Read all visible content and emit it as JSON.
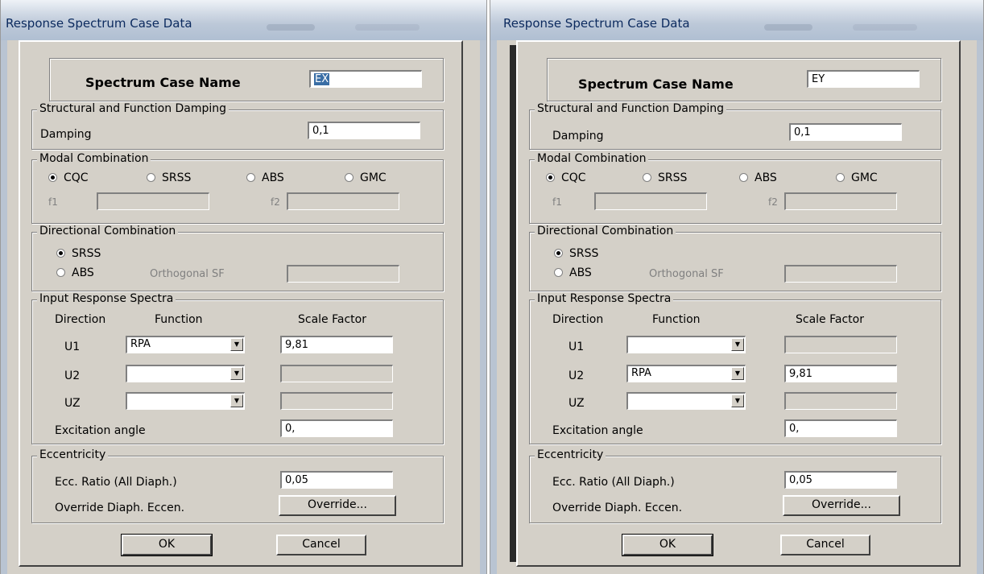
{
  "left": {
    "title": "Response Spectrum Case Data",
    "case_name_label": "Spectrum Case Name",
    "case_name": "EX",
    "damping_group": "Structural and Function Damping",
    "damping_label": "Damping",
    "damping": "0,1",
    "modal_group": "Modal Combination",
    "modal_options": [
      "CQC",
      "SRSS",
      "ABS",
      "GMC"
    ],
    "modal_selected": "CQC",
    "f1_label": "f1",
    "f2_label": "f2",
    "f1": "",
    "f2": "",
    "directional_group": "Directional Combination",
    "dir_options": [
      "SRSS",
      "ABS"
    ],
    "dir_selected": "SRSS",
    "orthogonal_label": "Orthogonal SF",
    "orthogonal": "",
    "input_group": "Input Response Spectra",
    "col_direction": "Direction",
    "col_function": "Function",
    "col_scale": "Scale Factor",
    "rows": [
      {
        "dir": "U1",
        "function": "RPA",
        "scale": "9,81"
      },
      {
        "dir": "U2",
        "function": "",
        "scale": ""
      },
      {
        "dir": "UZ",
        "function": "",
        "scale": ""
      }
    ],
    "excitation_label": "Excitation  angle",
    "excitation": "0,",
    "ecc_group": "Eccentricity",
    "ecc_ratio_label": "Ecc. Ratio (All Diaph.)",
    "ecc_ratio": "0,05",
    "override_label": "Override Diaph. Eccen.",
    "override_button": "Override...",
    "ok_button": "OK",
    "cancel_button": "Cancel"
  },
  "right": {
    "title": "Response Spectrum Case Data",
    "case_name_label": "Spectrum Case Name",
    "case_name": "EY",
    "damping_group": "Structural and Function Damping",
    "damping_label": "Damping",
    "damping": "0,1",
    "modal_group": "Modal Combination",
    "modal_options": [
      "CQC",
      "SRSS",
      "ABS",
      "GMC"
    ],
    "modal_selected": "CQC",
    "f1_label": "f1",
    "f2_label": "f2",
    "f1": "",
    "f2": "",
    "directional_group": "Directional Combination",
    "dir_options": [
      "SRSS",
      "ABS"
    ],
    "dir_selected": "SRSS",
    "orthogonal_label": "Orthogonal SF",
    "orthogonal": "",
    "input_group": "Input Response Spectra",
    "col_direction": "Direction",
    "col_function": "Function",
    "col_scale": "Scale Factor",
    "rows": [
      {
        "dir": "U1",
        "function": "",
        "scale": ""
      },
      {
        "dir": "U2",
        "function": "RPA",
        "scale": "9,81"
      },
      {
        "dir": "UZ",
        "function": "",
        "scale": ""
      }
    ],
    "excitation_label": "Excitation  angle",
    "excitation": "0,",
    "ecc_group": "Eccentricity",
    "ecc_ratio_label": "Ecc. Ratio (All Diaph.)",
    "ecc_ratio": "0,05",
    "override_label": "Override Diaph. Eccen.",
    "override_button": "Override...",
    "ok_button": "OK",
    "cancel_button": "Cancel"
  }
}
